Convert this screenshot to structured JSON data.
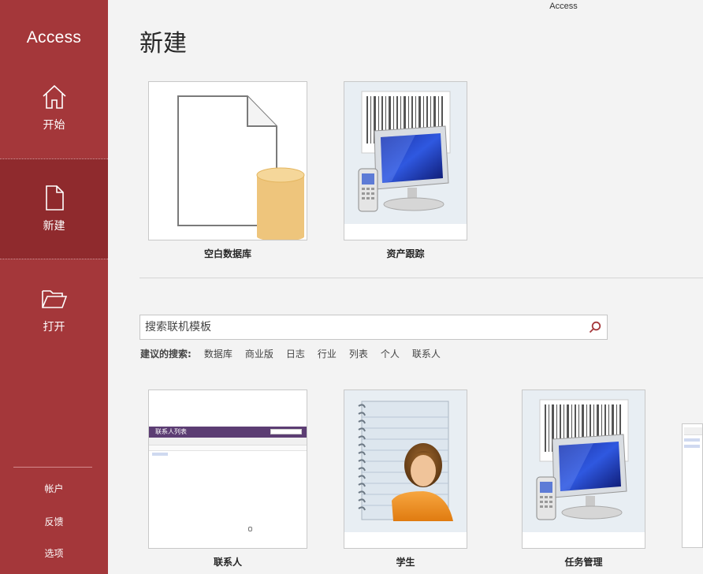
{
  "window": {
    "title": "Access"
  },
  "sidebar": {
    "app_name": "Access",
    "nav": [
      {
        "label": "开始",
        "icon": "home-icon"
      },
      {
        "label": "新建",
        "icon": "new-file-icon"
      },
      {
        "label": "打开",
        "icon": "open-folder-icon"
      }
    ],
    "bottom": [
      {
        "label": "帐户"
      },
      {
        "label": "反馈"
      },
      {
        "label": "选项"
      }
    ]
  },
  "main": {
    "title": "新建",
    "featured": [
      {
        "label": "空白数据库"
      },
      {
        "label": "资产跟踪"
      }
    ],
    "search": {
      "placeholder": "搜索联机模板",
      "suggest_label": "建议的搜索:",
      "suggestions": [
        "数据库",
        "商业版",
        "日志",
        "行业",
        "列表",
        "个人",
        "联系人"
      ]
    },
    "templates": [
      {
        "label": "联系人",
        "thumb_title": "联系人列表"
      },
      {
        "label": "学生"
      },
      {
        "label": "任务管理"
      }
    ]
  },
  "colors": {
    "sidebar": "#a4373a",
    "sidebar_selected": "#8f2a2d",
    "background": "#f3f3f3"
  }
}
